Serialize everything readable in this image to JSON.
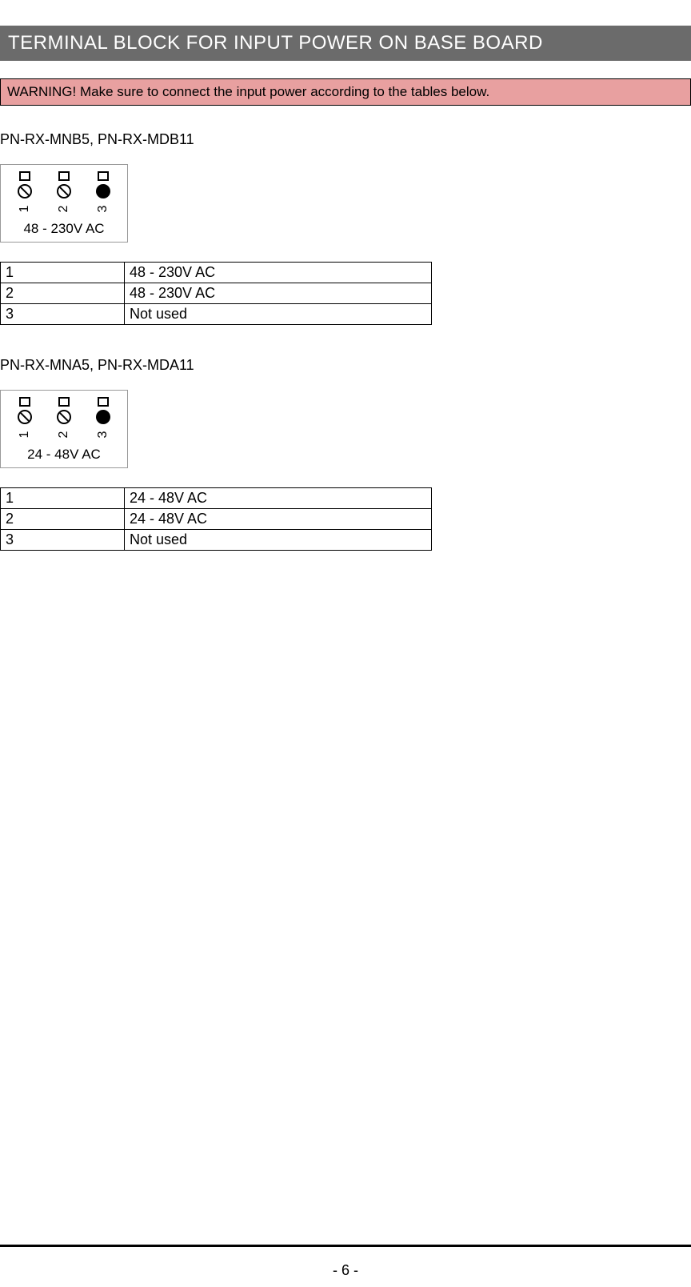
{
  "header": {
    "title": "TERMINAL BLOCK FOR INPUT POWER ON BASE BOARD"
  },
  "warning": {
    "text": "WARNING! Make sure to connect the input power according to the tables below."
  },
  "section1": {
    "heading": "PN-RX-MNB5, PN-RX-MDB11",
    "diagram": {
      "pin1": "1",
      "pin2": "2",
      "pin3": "3",
      "voltage": "48 - 230V AC"
    },
    "table": [
      {
        "pin": "1",
        "desc": "48 - 230V AC"
      },
      {
        "pin": "2",
        "desc": "48 - 230V AC"
      },
      {
        "pin": "3",
        "desc": "Not used"
      }
    ]
  },
  "section2": {
    "heading": "PN-RX-MNA5, PN-RX-MDA11",
    "diagram": {
      "pin1": "1",
      "pin2": "2",
      "pin3": "3",
      "voltage": "24 - 48V AC"
    },
    "table": [
      {
        "pin": "1",
        "desc": "24 - 48V AC"
      },
      {
        "pin": "2",
        "desc": "24 - 48V AC"
      },
      {
        "pin": "3",
        "desc": "Not used"
      }
    ]
  },
  "footer": {
    "page": "- 6 -"
  }
}
